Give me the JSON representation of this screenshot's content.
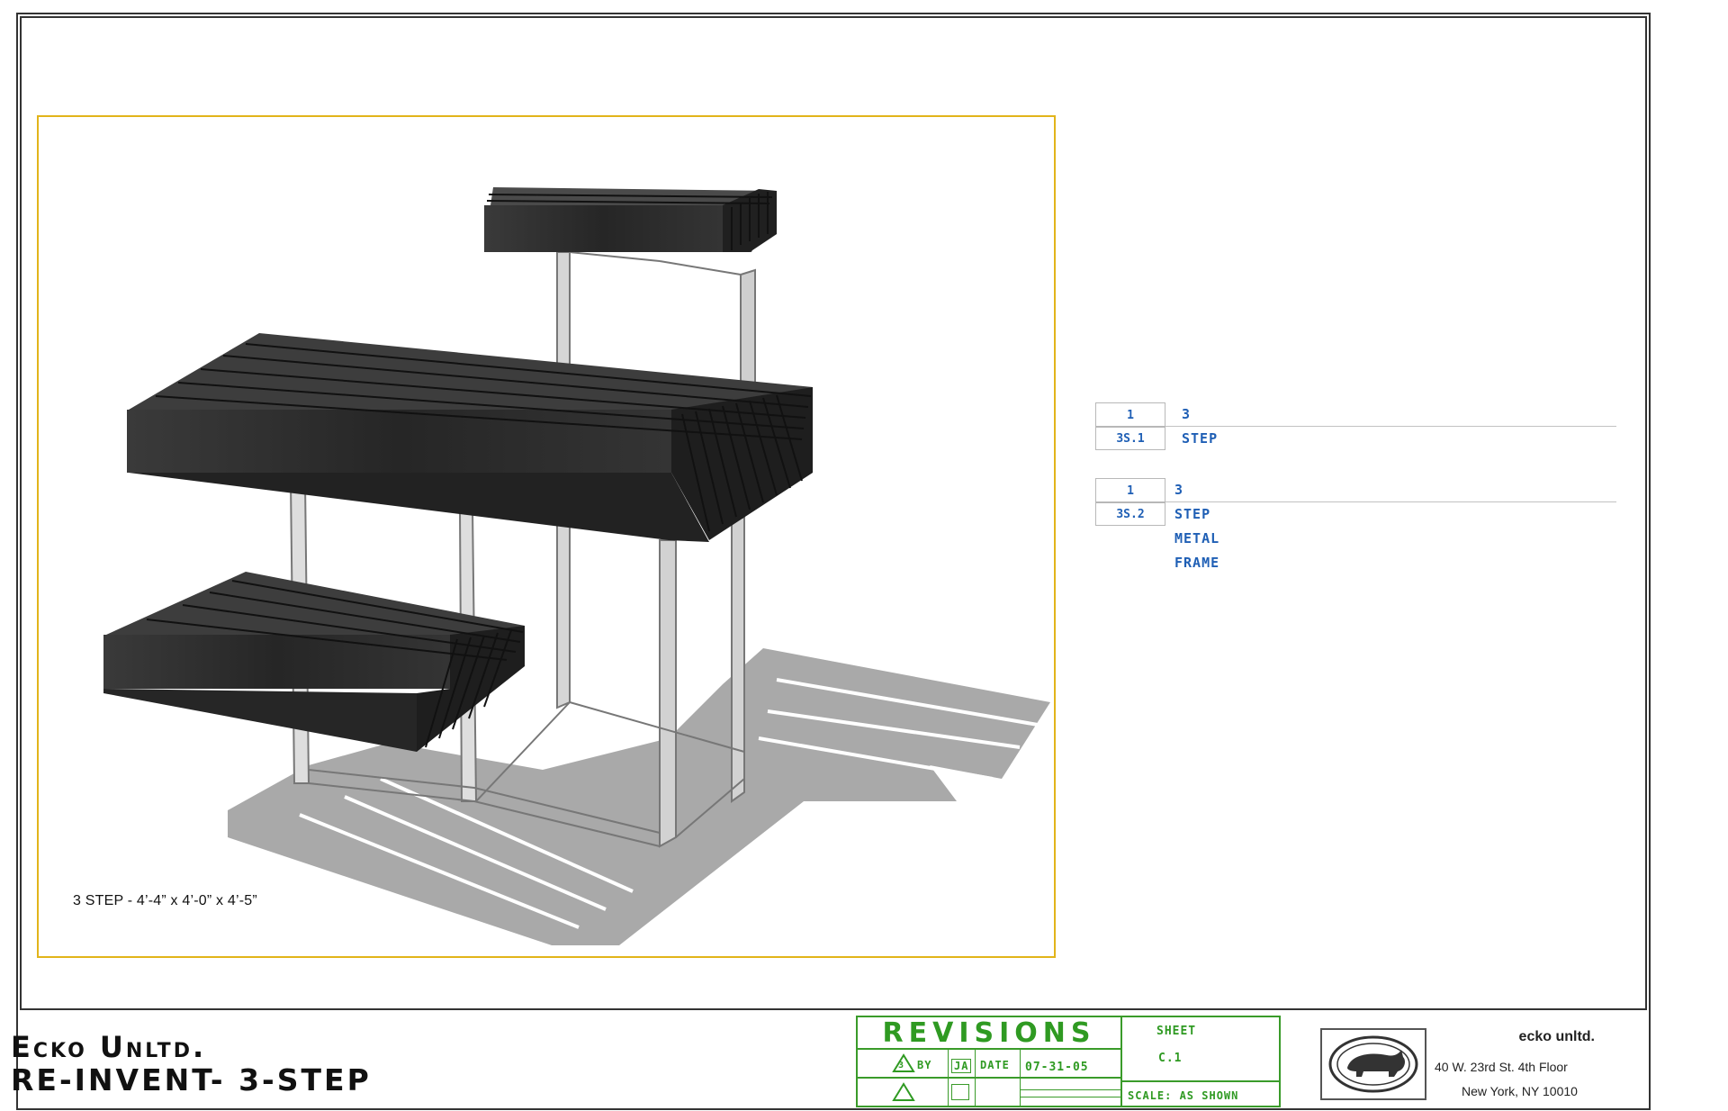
{
  "drawing": {
    "caption": "3 STEP - 4’-4” x 4’-0” x 4’-5”"
  },
  "references": [
    {
      "number": "1",
      "title": "3 STEP",
      "sheet": "3S.1"
    },
    {
      "number": "1",
      "title": "3 STEP METAL FRAME",
      "sheet": "3S.2"
    }
  ],
  "title_block": {
    "company": "Ecko Unltd.",
    "project": "RE-INVENT- 3-STEP",
    "revisions": {
      "title": "REVISIONS",
      "rev_number": "3",
      "by_label": "BY",
      "by": "JA",
      "date_label": "DATE",
      "date": "07-31-05"
    },
    "sheet": {
      "label": "SHEET",
      "number": "C.1",
      "scale": "SCALE: AS SHOWN"
    },
    "brand": "ecko unltd.",
    "address_line1": "40 W. 23rd St. 4th Floor",
    "address_line2": "New York, NY 10010"
  },
  "colors": {
    "viewport_border": "#e2b41a",
    "reference_text": "#1f5fb5",
    "revisions_green": "#2f9a22",
    "wood": "#2b2b2b",
    "shadow": "#a9a9a9"
  },
  "icons": {
    "revision_marker": "triangle-icon",
    "logo": "rhino-logo-icon"
  }
}
